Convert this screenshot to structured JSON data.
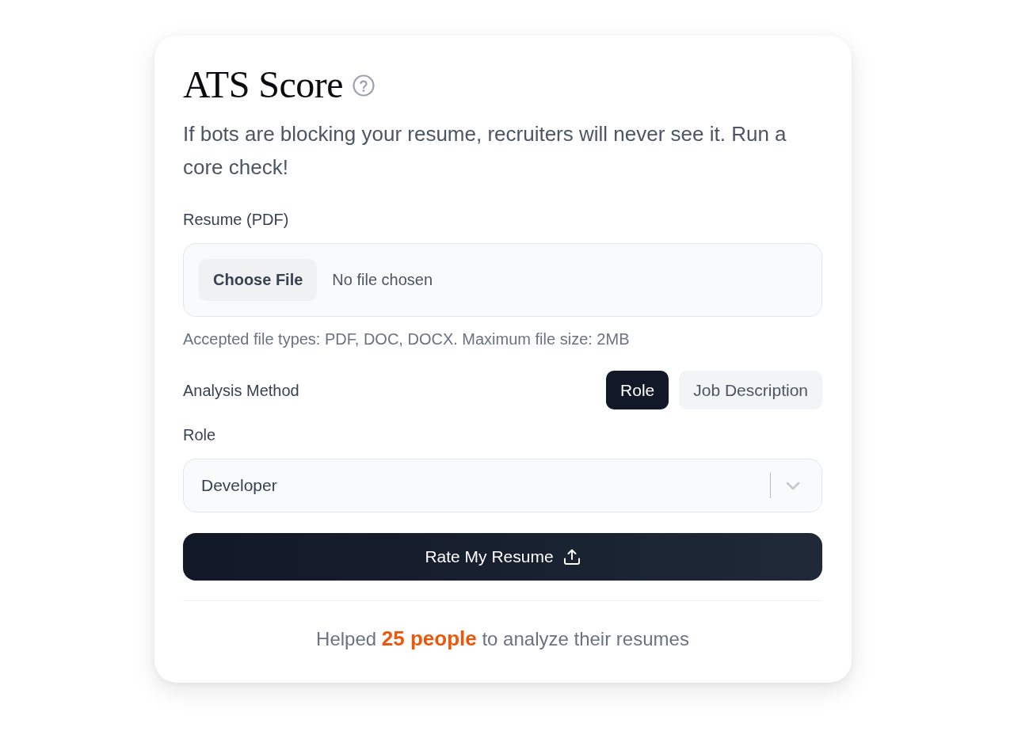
{
  "card": {
    "title": "ATS Score",
    "description": "If bots are blocking your resume, recruiters will never see it. Run a core check!",
    "resume_field": {
      "label": "Resume (PDF)",
      "button": "Choose File",
      "status": "No file chosen",
      "hint": "Accepted file types: PDF, DOC, DOCX. Maximum file size: 2MB"
    },
    "analysis_method": {
      "label": "Analysis Method",
      "options": [
        {
          "label": "Role",
          "selected": true
        },
        {
          "label": "Job Description",
          "selected": false
        }
      ]
    },
    "role_field": {
      "label": "Role",
      "value": "Developer"
    },
    "submit_button": "Rate My Resume",
    "footer": "Helped **25 people** to analyze their resumes"
  }
}
